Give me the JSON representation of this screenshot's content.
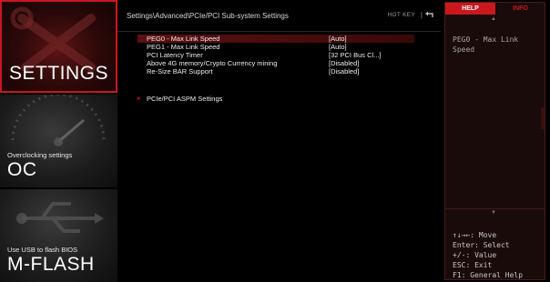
{
  "nav": {
    "settings": {
      "title": "SETTINGS"
    },
    "oc": {
      "subtitle": "Overclocking settings",
      "title": "OC"
    },
    "mflash": {
      "subtitle": "Use USB to flash BIOS",
      "title": "M-FLASH"
    }
  },
  "header": {
    "breadcrumb": "Settings\\Advanced\\PCIe/PCI Sub-system Settings",
    "hotkey_label": "HOT KEY",
    "hotkey_separator": "|"
  },
  "settings_rows": [
    {
      "label": "PEG0 - Max Link Speed",
      "value": "[Auto]",
      "selected": true
    },
    {
      "label": "PEG1 - Max Link Speed",
      "value": "[Auto]"
    },
    {
      "label": "PCI Latency Timer",
      "value": "[32 PCI Bus Cl...]"
    },
    {
      "label": "Above 4G memory/Crypto Currency mining",
      "value": "[Disabled]"
    },
    {
      "label": "Re-Size BAR Support",
      "value": "[Disabled]"
    }
  ],
  "submenu": {
    "arrow": "▸",
    "label": "PCIe/PCI ASPM Settings"
  },
  "help_panel": {
    "tabs": {
      "help": "HELP",
      "info": "INFO"
    },
    "description": "PEG0 - Max Link Speed",
    "keys": [
      "↑↓→←: Move",
      "Enter: Select",
      "+/-: Value",
      "ESC: Exit",
      "F1: General Help"
    ]
  },
  "colors": {
    "accent": "#c8181e",
    "selected_row": "#5c1010",
    "panel_bg": "#1a0b0b"
  }
}
